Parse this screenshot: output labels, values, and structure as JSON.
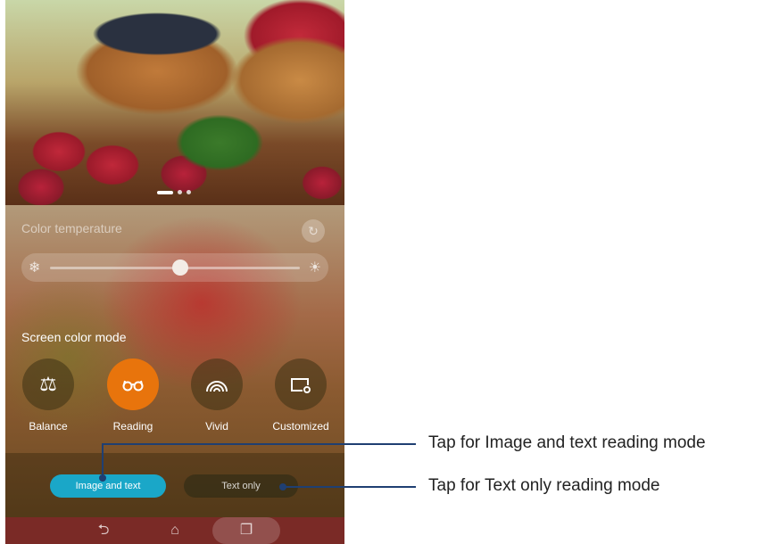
{
  "photo": {
    "carousel_pages": 3,
    "active_page": 1
  },
  "color_temperature": {
    "label": "Color temperature",
    "level_fraction": 0.52,
    "icons": {
      "cold": "snowflake-icon",
      "warm": "sun-icon",
      "reset": "reset-icon"
    }
  },
  "screen_color_mode": {
    "label": "Screen color mode",
    "modes": [
      {
        "label": "Balance",
        "icon": "balance-scale-icon",
        "active": false
      },
      {
        "label": "Reading",
        "icon": "glasses-icon",
        "active": true
      },
      {
        "label": "Vivid",
        "icon": "rainbow-icon",
        "active": false
      },
      {
        "label": "Customized",
        "icon": "custom-settings-icon",
        "active": false
      }
    ]
  },
  "reading_options": {
    "image_and_text": "Image and text",
    "text_only": "Text only"
  },
  "callouts": {
    "image_and_text": "Tap for Image and text reading mode",
    "text_only": "Tap for Text only reading mode"
  },
  "colors": {
    "accent_orange": "#e8740c",
    "accent_cyan": "#1aa7c8",
    "callout_line": "#1f3f72"
  }
}
